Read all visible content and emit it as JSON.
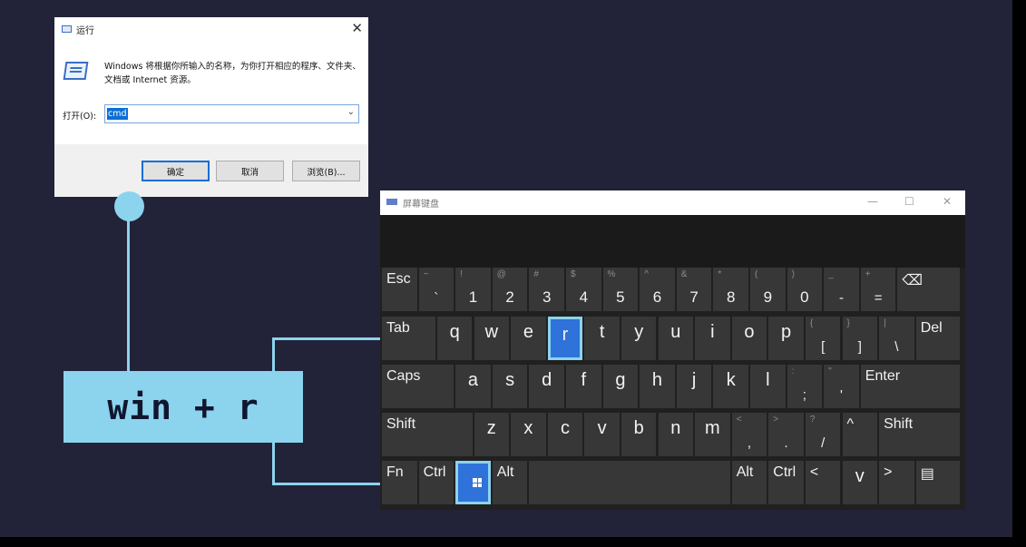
{
  "run_dialog": {
    "title": "运行",
    "description": "Windows 将根据你所输入的名称，为你打开相应的程序、文件夹、文档或 Internet 资源。",
    "open_label": "打开(O):",
    "open_value": "cmd",
    "ok_label": "确定",
    "cancel_label": "取消",
    "browse_label": "浏览(B)...",
    "close_glyph": "✕",
    "dropdown_glyph": "⌄"
  },
  "shortcut_label": "win + r",
  "osk": {
    "title": "屏幕键盘",
    "minimize_glyph": "—",
    "maximize_glyph": "☐",
    "close_glyph": "✕",
    "row1": [
      {
        "main": "Esc",
        "shift": ""
      },
      {
        "main": "`",
        "shift": "~"
      },
      {
        "main": "1",
        "shift": "!"
      },
      {
        "main": "2",
        "shift": "@"
      },
      {
        "main": "3",
        "shift": "#"
      },
      {
        "main": "4",
        "shift": "$"
      },
      {
        "main": "5",
        "shift": "%"
      },
      {
        "main": "6",
        "shift": "^"
      },
      {
        "main": "7",
        "shift": "&"
      },
      {
        "main": "8",
        "shift": "*"
      },
      {
        "main": "9",
        "shift": "("
      },
      {
        "main": "0",
        "shift": ")"
      },
      {
        "main": "-",
        "shift": "_"
      },
      {
        "main": "=",
        "shift": "+"
      },
      {
        "main": "⌫",
        "shift": ""
      }
    ],
    "row2": [
      {
        "main": "Tab",
        "shift": ""
      },
      {
        "main": "q"
      },
      {
        "main": "w"
      },
      {
        "main": "e"
      },
      {
        "main": "r"
      },
      {
        "main": "t"
      },
      {
        "main": "y"
      },
      {
        "main": "u"
      },
      {
        "main": "i"
      },
      {
        "main": "o"
      },
      {
        "main": "p"
      },
      {
        "main": "[",
        "shift": "{"
      },
      {
        "main": "]",
        "shift": "}"
      },
      {
        "main": "\\",
        "shift": "|"
      },
      {
        "main": "Del"
      }
    ],
    "row3": [
      {
        "main": "Caps"
      },
      {
        "main": "a"
      },
      {
        "main": "s"
      },
      {
        "main": "d"
      },
      {
        "main": "f"
      },
      {
        "main": "g"
      },
      {
        "main": "h"
      },
      {
        "main": "j"
      },
      {
        "main": "k"
      },
      {
        "main": "l"
      },
      {
        "main": ";",
        "shift": ":"
      },
      {
        "main": "'",
        "shift": "\""
      },
      {
        "main": "Enter"
      }
    ],
    "row4": [
      {
        "main": "Shift"
      },
      {
        "main": "z"
      },
      {
        "main": "x"
      },
      {
        "main": "c"
      },
      {
        "main": "v"
      },
      {
        "main": "b"
      },
      {
        "main": "n"
      },
      {
        "main": "m"
      },
      {
        "main": ",",
        "shift": "<"
      },
      {
        "main": ".",
        "shift": ">"
      },
      {
        "main": "/",
        "shift": "?"
      },
      {
        "main": "^"
      },
      {
        "main": "Shift"
      }
    ],
    "row5": [
      {
        "main": "Fn"
      },
      {
        "main": "Ctrl"
      },
      {
        "main": ""
      },
      {
        "main": "Alt"
      },
      {
        "main": ""
      },
      {
        "main": "Alt"
      },
      {
        "main": "Ctrl"
      },
      {
        "main": "<"
      },
      {
        "main": "v"
      },
      {
        "main": ">"
      },
      {
        "main": "▤"
      }
    ],
    "highlighted_keys": [
      "r",
      "win"
    ],
    "highlight_color": "#2f72d9",
    "accent_color": "#8cd3ee"
  }
}
